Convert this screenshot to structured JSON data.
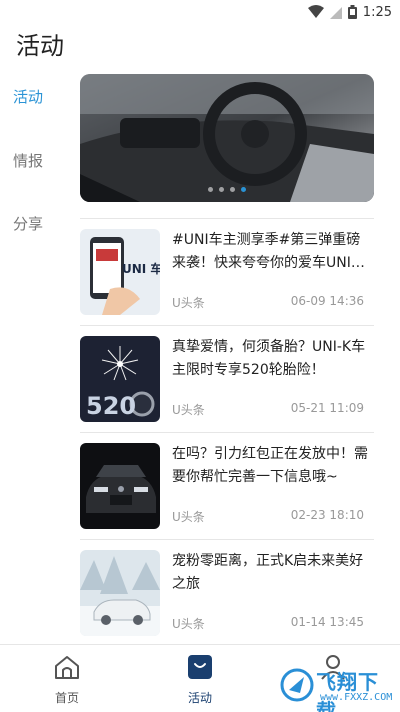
{
  "status_bar": {
    "time": "1:25"
  },
  "page": {
    "title": "活动"
  },
  "side_nav": {
    "items": [
      {
        "label": "活动",
        "active": true
      },
      {
        "label": "情报",
        "active": false
      },
      {
        "label": "分享",
        "active": false
      }
    ]
  },
  "banner": {
    "dots": 4,
    "active_dot": 3
  },
  "feed": {
    "items": [
      {
        "title": "#UNI车主测享季#第三弹重磅来袭！快来夸夸你的爱车UNI…",
        "source": "U头条",
        "date": "06-09 14:36",
        "thumb_text": "UNI 车主测享季"
      },
      {
        "title": "真挚爱情，何须备胎？UNI-K车主限时专享520轮胎险！",
        "source": "U头条",
        "date": "05-21 11:09",
        "thumb_text": "520"
      },
      {
        "title": "在吗？引力红包正在发放中！需要你帮忙完善一下信息哦~",
        "source": "U头条",
        "date": "02-23 18:10",
        "thumb_text": ""
      },
      {
        "title": "宠粉零距离，正式K启未来美好之旅",
        "source": "U头条",
        "date": "01-14 13:45",
        "thumb_text": ""
      }
    ]
  },
  "bottom_nav": {
    "tabs": [
      {
        "label": "首页",
        "icon": "home-icon",
        "active": false
      },
      {
        "label": "活动",
        "icon": "bag-icon",
        "active": true
      },
      {
        "label": "",
        "icon": "profile-icon",
        "active": false
      }
    ]
  },
  "watermark": {
    "text": "飞翔下载",
    "url": "www.FXXZ.COM"
  },
  "colors": {
    "accent": "#2a93d5",
    "active_tab": "#1a3f6f",
    "divider": "#e6e6e6"
  }
}
